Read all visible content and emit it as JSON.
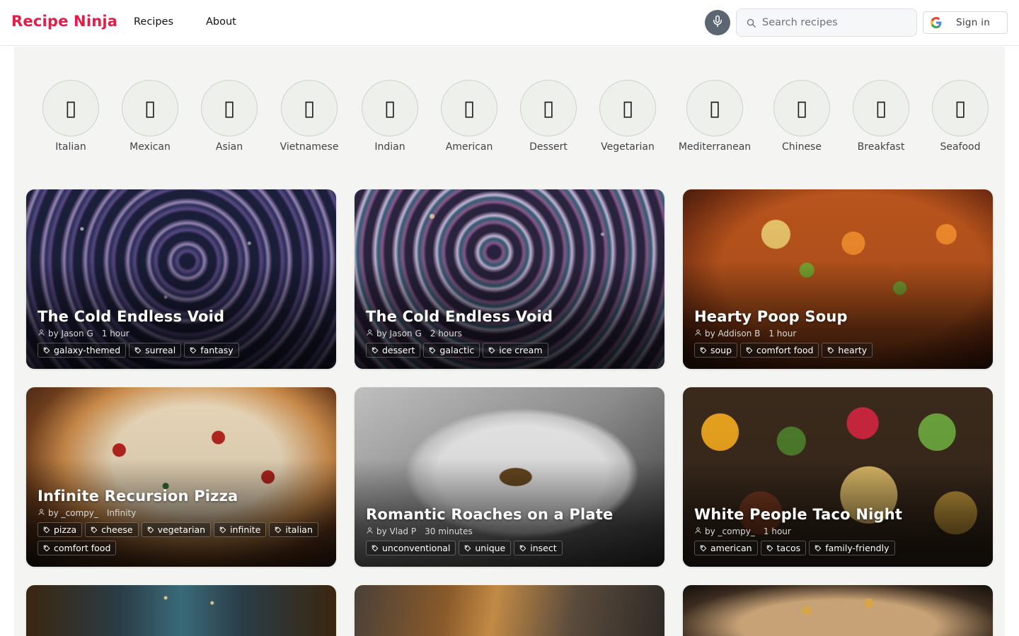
{
  "header": {
    "logo": "Recipe Ninja",
    "nav": [
      "Recipes",
      "About"
    ],
    "search_placeholder": "Search recipes",
    "signin_label": "Sign in",
    "mic_icon": "microphone-icon",
    "search_icon": "search-icon",
    "google_icon": "google-g-icon"
  },
  "categories": [
    {
      "label": "Italian",
      "icon": "▯"
    },
    {
      "label": "Mexican",
      "icon": "▯"
    },
    {
      "label": "Asian",
      "icon": "▯"
    },
    {
      "label": "Vietnamese",
      "icon": "▯"
    },
    {
      "label": "Indian",
      "icon": "▯"
    },
    {
      "label": "American",
      "icon": "▯"
    },
    {
      "label": "Dessert",
      "icon": "▯"
    },
    {
      "label": "Vegetarian",
      "icon": "▯"
    },
    {
      "label": "Mediterranean",
      "icon": "▯"
    },
    {
      "label": "Chinese",
      "icon": "▯"
    },
    {
      "label": "Breakfast",
      "icon": "▯"
    },
    {
      "label": "Seafood",
      "icon": "▯"
    }
  ],
  "recipes": [
    {
      "title": "The Cold Endless Void",
      "author": "by Jason G",
      "time": "1 hour",
      "tags": [
        "galaxy-themed",
        "surreal",
        "fantasy"
      ]
    },
    {
      "title": "The Cold Endless Void",
      "author": "by Jason G",
      "time": "2 hours",
      "tags": [
        "dessert",
        "galactic",
        "ice cream"
      ]
    },
    {
      "title": "Hearty Poop Soup",
      "author": "by Addison B",
      "time": "1 hour",
      "tags": [
        "soup",
        "comfort food",
        "hearty"
      ]
    },
    {
      "title": "Infinite Recursion Pizza",
      "author": "by _compy_",
      "time": "Infinity",
      "tags": [
        "pizza",
        "cheese",
        "vegetarian",
        "infinite",
        "italian",
        "comfort food"
      ]
    },
    {
      "title": "Romantic Roaches on a Plate",
      "author": "by Vlad P",
      "time": "30 minutes",
      "tags": [
        "unconventional",
        "unique",
        "insect"
      ]
    },
    {
      "title": "White People Taco Night",
      "author": "by _compy_",
      "time": "1 hour",
      "tags": [
        "american",
        "tacos",
        "family-friendly"
      ]
    }
  ],
  "colors": {
    "brand": "#e11d48",
    "mic_button": "#5b6672",
    "page_background": "#f4f5f2"
  }
}
